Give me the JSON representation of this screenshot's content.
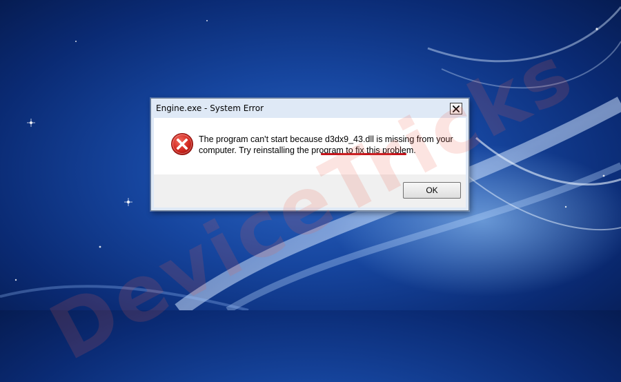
{
  "dialog": {
    "title": "Engine.exe - System Error",
    "close_glyph": "✕",
    "icon": "error-icon",
    "message_pre": "The program can't start because ",
    "message_highlight": "d3dx9_43.dll is missing",
    "message_post": " from your computer. Try reinstalling the program to fix this problem.",
    "ok_label": "OK"
  },
  "watermark": {
    "text": "DeviceTricks"
  },
  "colors": {
    "underline": "#c4141b",
    "error_red": "#d42a22",
    "wallpaper_blue": "#16459e"
  }
}
